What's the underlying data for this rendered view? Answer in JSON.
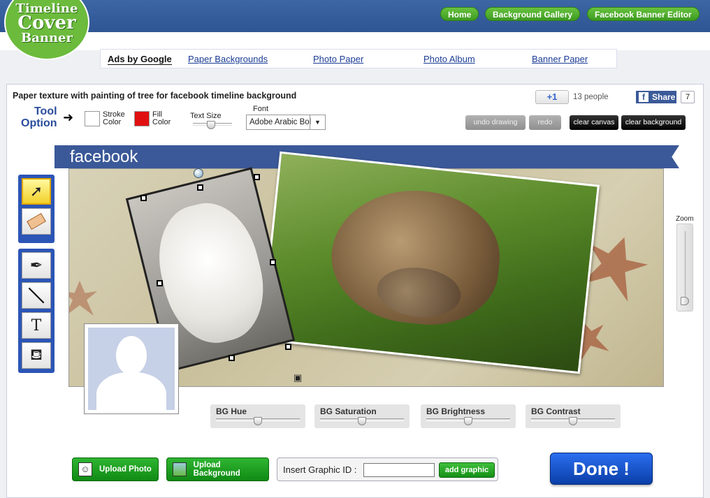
{
  "logo": {
    "line1": "Timeline",
    "line2": "Cover",
    "line3": "Banner"
  },
  "nav": {
    "home": "Home",
    "gallery": "Background Gallery",
    "editor": "Facebook Banner Editor"
  },
  "ads": {
    "label": "Ads by Google",
    "links": [
      "Paper Backgrounds",
      "Photo Paper",
      "Photo Album",
      "Banner Paper"
    ]
  },
  "page_title": "Paper texture with painting of tree for facebook timeline background",
  "social": {
    "plus_label": "+1",
    "people": "13 people",
    "share_label": "Share",
    "share_count": "7"
  },
  "toolbar": {
    "tool_option_1": "Tool",
    "tool_option_2": "Option",
    "stroke_1": "Stroke",
    "stroke_2": "Color",
    "fill_1": "Fill",
    "fill_2": "Color",
    "text_size": "Text Size",
    "font_label": "Font",
    "font_value": "Adobe Arabic Bol",
    "undo": "undo drawing",
    "redo": "redo",
    "clear_canvas": "clear canvas",
    "clear_background": "clear background",
    "stroke_color": "#ffffff",
    "fill_color": "#e01010",
    "text_size_level": 0.45
  },
  "banner_label": "facebook",
  "zoom": {
    "label": "Zoom",
    "level": 0.0
  },
  "bg_controls": [
    {
      "label": "BG Hue",
      "level": 0.5
    },
    {
      "label": "BG Saturation",
      "level": 0.5
    },
    {
      "label": "BG Brightness",
      "level": 0.5
    },
    {
      "label": "BG Contrast",
      "level": 0.5
    }
  ],
  "actions": {
    "upload_photo": "Upload  Photo",
    "upload_background": "Upload Background",
    "insert_label": "Insert Graphic ID :",
    "insert_value": "",
    "add_graphic": "add graphic",
    "done": "Done !"
  }
}
